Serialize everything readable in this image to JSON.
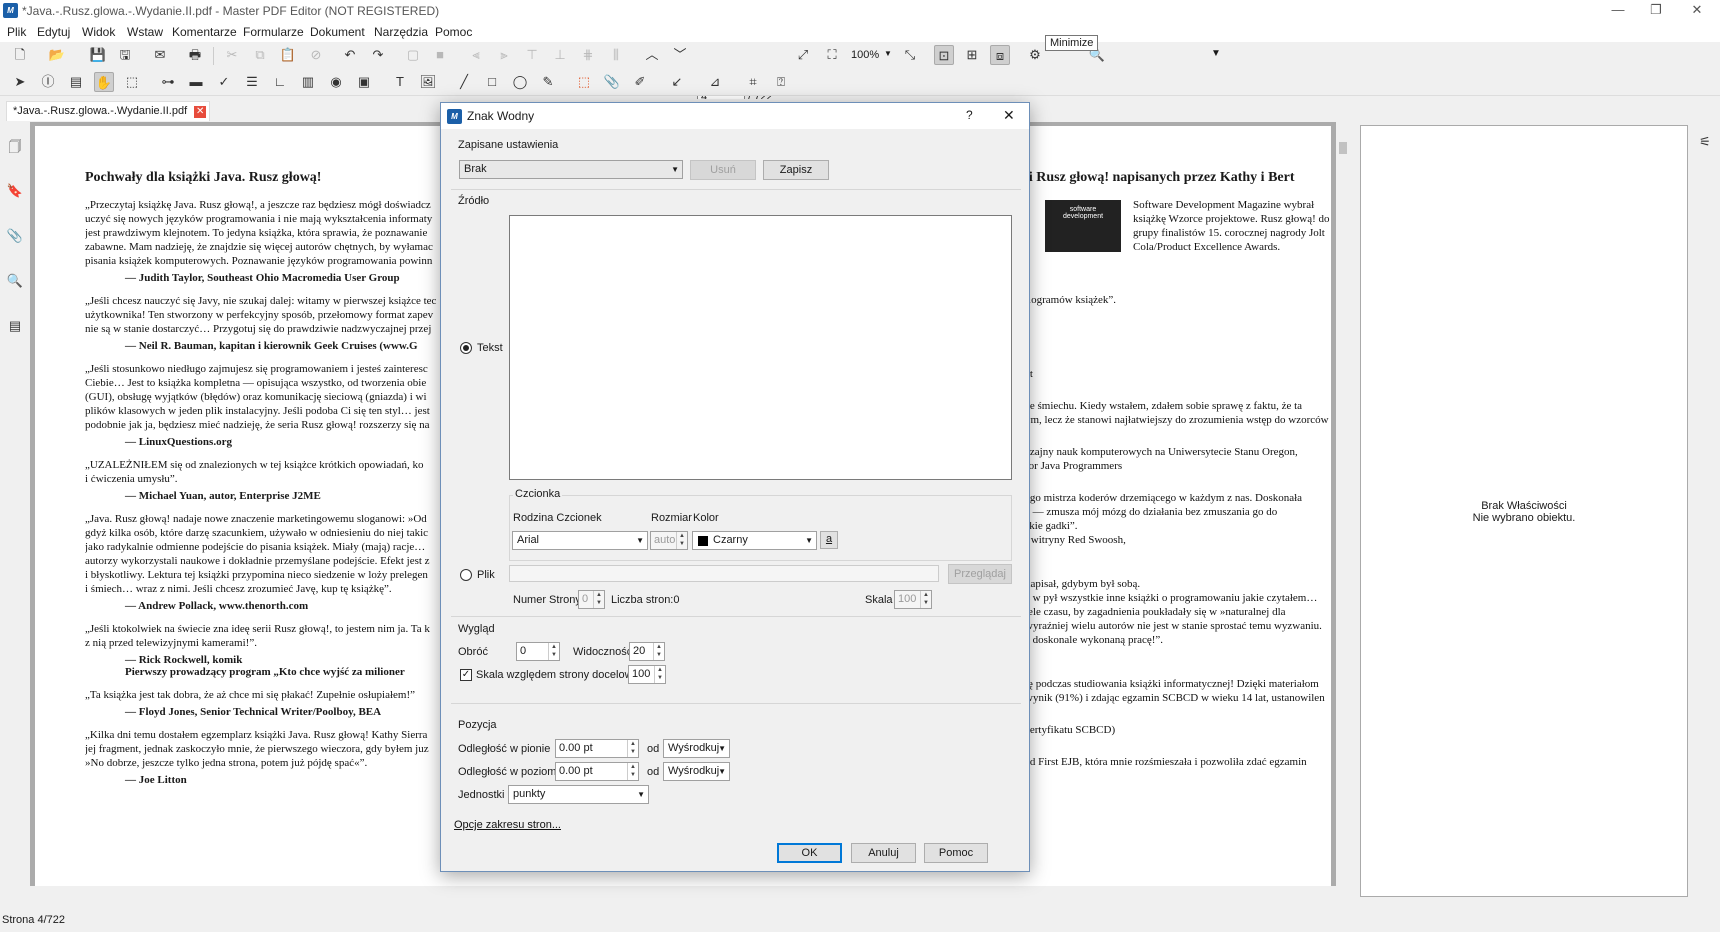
{
  "window": {
    "title": "*Java.-.Rusz.glowa.-.Wydanie.II.pdf - Master PDF Editor (NOT REGISTERED)",
    "app_icon": "M",
    "minimize": "—",
    "maximize": "❐",
    "close": "✕"
  },
  "menu": [
    "Plik",
    "Edytuj",
    "Widok",
    "Wstaw",
    "Komentarze",
    "Formularze",
    "Dokument",
    "Narzędzia",
    "Pomoc"
  ],
  "toolbar": {
    "page_current": "4",
    "page_total": "/ 722",
    "zoom": "100%",
    "tooltip": "Minimize"
  },
  "tab": {
    "label": "*Java.-.Rusz.glowa.-.Wydanie.II.pdf",
    "close": "✕"
  },
  "document": {
    "heading_left": "Pochwały dla książki Java. Rusz głową!",
    "heading_right": "ii Rusz głową! napisanych przez Kathy i Bert",
    "left_blocks": [
      {
        "lines": [
          "„Przeczytaj książkę Java. Rusz głową!, a jeszcze raz będziesz mógł doświadcz",
          "uczyć się nowych języków programowania i nie mają wykształcenia informaty",
          "jest prawdziwym klejnotem. To jedyna książka, która sprawia, że poznawanie",
          "zabawne. Mam nadzieję, że znajdzie się więcej autorów chętnych, by wyłamac",
          "pisania książek komputerowych. Poznawanie języków programowania powinn"
        ],
        "author": [
          "—  Judith Taylor, Southeast Ohio Macromedia User Group"
        ]
      },
      {
        "lines": [
          "„Jeśli chcesz nauczyć się Javy, nie szukaj dalej: witamy w pierwszej książce tec",
          "użytkownika! Ten stworzony w perfekcyjny sposób, przełomowy format zapev",
          "nie są w stanie dostarczyć… Przygotuj się do prawdziwie nadzwyczajnej przej"
        ],
        "author": [
          "—  Neil R. Bauman, kapitan i kierownik Geek Cruises (www.G"
        ]
      },
      {
        "lines": [
          "„Jeśli stosunkowo niedługo zajmujesz się programowaniem i jesteś zainteresc",
          "Ciebie… Jest to książka kompletna — opisująca wszystko, od tworzenia obie",
          "(GUI), obsługę wyjątków (błędów) oraz komunikację sieciową (gniazda) i wi",
          "plików klasowych w jeden plik instalacyjny. Jeśli podoba Ci się ten styl… jest",
          "podobnie jak ja, będziesz mieć nadzieję, że seria Rusz głową! rozszerzy się na"
        ],
        "author": [
          "—  LinuxQuestions.org"
        ]
      },
      {
        "lines": [
          "„UZALEŻNIŁEM się od znalezionych w tej książce krótkich opowiadań, ko",
          "i ćwiczenia umysłu”."
        ],
        "author": [
          "—  Michael Yuan, autor, Enterprise J2ME"
        ]
      },
      {
        "lines": [
          "„Java. Rusz głową! nadaje nowe znaczenie marketingowemu sloganowi: »Od",
          "gdyż kilka osób, które darzę szacunkiem, używało w odniesieniu do niej takic",
          "jako radykalnie odmienne podejście do pisania książek. Miały (mają) racje…",
          "autorzy wykorzystali naukowe i dokładnie przemyślane podejście. Efekt jest z",
          "i błyskotliwy. Lektura tej książki przypomina nieco siedzenie w loży prelegen",
          "i śmiech… wraz z nimi. Jeśli chcesz zrozumieć Javę, kup tę książkę”."
        ],
        "author": [
          "—  Andrew Pollack, www.thenorth.com"
        ]
      },
      {
        "lines": [
          "„Jeśli ktokolwiek na świecie zna ideę serii Rusz głową!, to jestem nim ja. Ta k",
          "z nią przed telewizyjnymi kamerami!”."
        ],
        "author": [
          "—  Rick Rockwell, komik",
          "     Pierwszy prowadzący program „Kto chce wyjść za milioner"
        ]
      },
      {
        "lines": [
          "„Ta książka jest tak dobra, że aż chce mi się płakać! Zupełnie osłupiałem!”"
        ],
        "author": [
          "—  Floyd Jones, Senior Technical Writer/Poolboy, BEA"
        ]
      },
      {
        "lines": [
          "„Kilka dni temu dostałem egzemplarz książki Java. Rusz głową! Kathy Sierra",
          "jej fragment, jednak zaskoczyło mnie, że pierwszego wieczora, gdy byłem juz",
          "»No dobrze, jeszcze tylko jedna strona, potem już pójdę spać«”."
        ],
        "author": [
          "—  Joe Litton"
        ]
      }
    ],
    "right_award": [
      "Software Development Magazine wybrał",
      "książkę Wzorce projektowe. Rusz głową! do",
      "grupy finalistów 15. corocznej nagrody Jolt",
      "Cola/Product Excellence Awards."
    ],
    "right_lines": [
      "ilogramów książek”.",
      "et",
      "ze śmiechu. Kiedy wstałem, zdałem sobie sprawę z faktu, że ta",
      "ym, lecz że stanowi najłatwiejszy do zrozumienia wstęp do wzorców",
      "czajny nauk komputerowych na Uniwersytecie Stanu Oregon,",
      "for Java Programmers",
      "ego mistrza koderów drzemiącego w każdym z nas. Doskonała",
      "a — zmusza mój mózg do działania bez zmuszania go do",
      "skie gadki”.",
      "i witryny Red Swoosh,",
      " napisał, gdybym był sobą.",
      "a w pył wszystkie inne książki o programowaniu jakie czytałem…",
      "iele czasu, by zagadnienia poukładały się w »naturalnej dla",
      "wyraźniej wielu autorów nie jest w stanie sprostać temu wyzwaniu.",
      "a doskonale wykonaną pracę!”.",
      "ię podczas studiowania książki informatycznej! Dzięki materiałom",
      "wynik (91%) i zdając egzamin SCBCD w wieku 14 lat, ustanowilen",
      " certyfikatu SCBCD)",
      "ad First EJB, która mnie rozśmieszała i pozwoliła zdać egzamin"
    ]
  },
  "properties": {
    "line1": "Brak Właściwości",
    "line2": "Nie wybrano obiektu."
  },
  "status": "Strona 4/722",
  "dialog": {
    "title": "Znak Wodny",
    "help": "?",
    "close": "✕",
    "saved_label": "Zapisane ustawienia",
    "saved_value": "Brak",
    "delete": "Usuń",
    "save": "Zapisz",
    "source_label": "Źródło",
    "text_radio": "Tekst",
    "file_radio": "Plik",
    "font_group": "Czcionka",
    "font_family_label": "Rodzina Czcionek",
    "size_label": "Rozmiar",
    "color_label": "Kolor",
    "font_family": "Arial",
    "size": "auto",
    "color": "Czarny",
    "color_swatch": "#000000",
    "text_style": "a",
    "browse": "Przeglądaj",
    "page_num_label": "Numer Strony",
    "page_num": "0",
    "page_count": "Liczba stron:0",
    "scale_label": "Skala",
    "scale": "100",
    "look_label": "Wygląd",
    "rotate_label": "Obróć",
    "rotate": "0",
    "opacity_label": "Widoczność",
    "opacity": "20",
    "scale_rel_label": "Skala względem strony docelowej",
    "scale_rel": "100",
    "position_label": "Pozycja",
    "vdist_label": "Odległość w pionie",
    "vdist": "0.00 pt",
    "from": "od",
    "valign": "Wyśrodkuj",
    "hdist_label": "Odległość w poziomie",
    "hdist": "0.00 pt",
    "halign": "Wyśrodkuj",
    "units_label": "Jednostki",
    "units": "punkty",
    "page_range": "Opcje zakresu stron...",
    "ok": "OK",
    "cancel": "Anuluj",
    "help_btn": "Pomoc"
  }
}
